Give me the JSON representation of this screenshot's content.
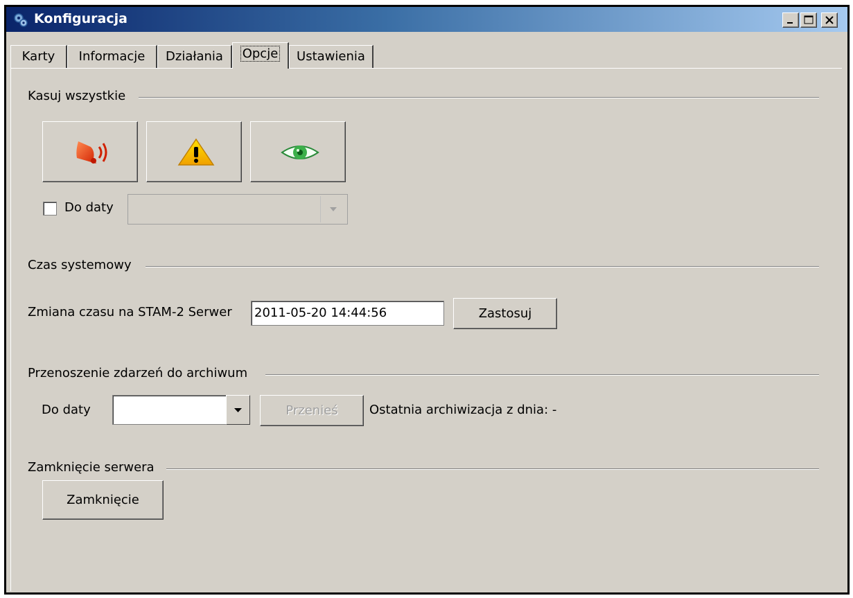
{
  "window": {
    "title": "Konfiguracja",
    "icon": "gears-icon"
  },
  "tabs": [
    {
      "label": "Karty"
    },
    {
      "label": "Informacje"
    },
    {
      "label": "Działania"
    },
    {
      "label": "Opcje",
      "active": true
    },
    {
      "label": "Ustawienia"
    }
  ],
  "sections": {
    "clear_all": {
      "label": "Kasuj wszystkie",
      "buttons": [
        "bell-alarm-icon",
        "warning-icon",
        "eye-icon"
      ],
      "to_date_checkbox_label": "Do daty",
      "to_date_checked": false
    },
    "system_time": {
      "label": "Czas systemowy",
      "change_label": "Zmiana czasu na STAM-2 Serwer",
      "time_value": "2011-05-20 14:44:56",
      "apply_label": "Zastosuj"
    },
    "archive": {
      "label": "Przenoszenie zdarzeń do archiwum",
      "to_date_label": "Do daty",
      "date_value": "",
      "move_label": "Przenieś",
      "last_archive_label": "Ostatnia archiwizacja z dnia: -"
    },
    "shutdown": {
      "label": "Zamknięcie serwera",
      "button_label": "Zamknięcie"
    }
  },
  "colors": {
    "title_start": "#0a246a",
    "title_end": "#a6caf0",
    "face": "#d4d0c8"
  }
}
